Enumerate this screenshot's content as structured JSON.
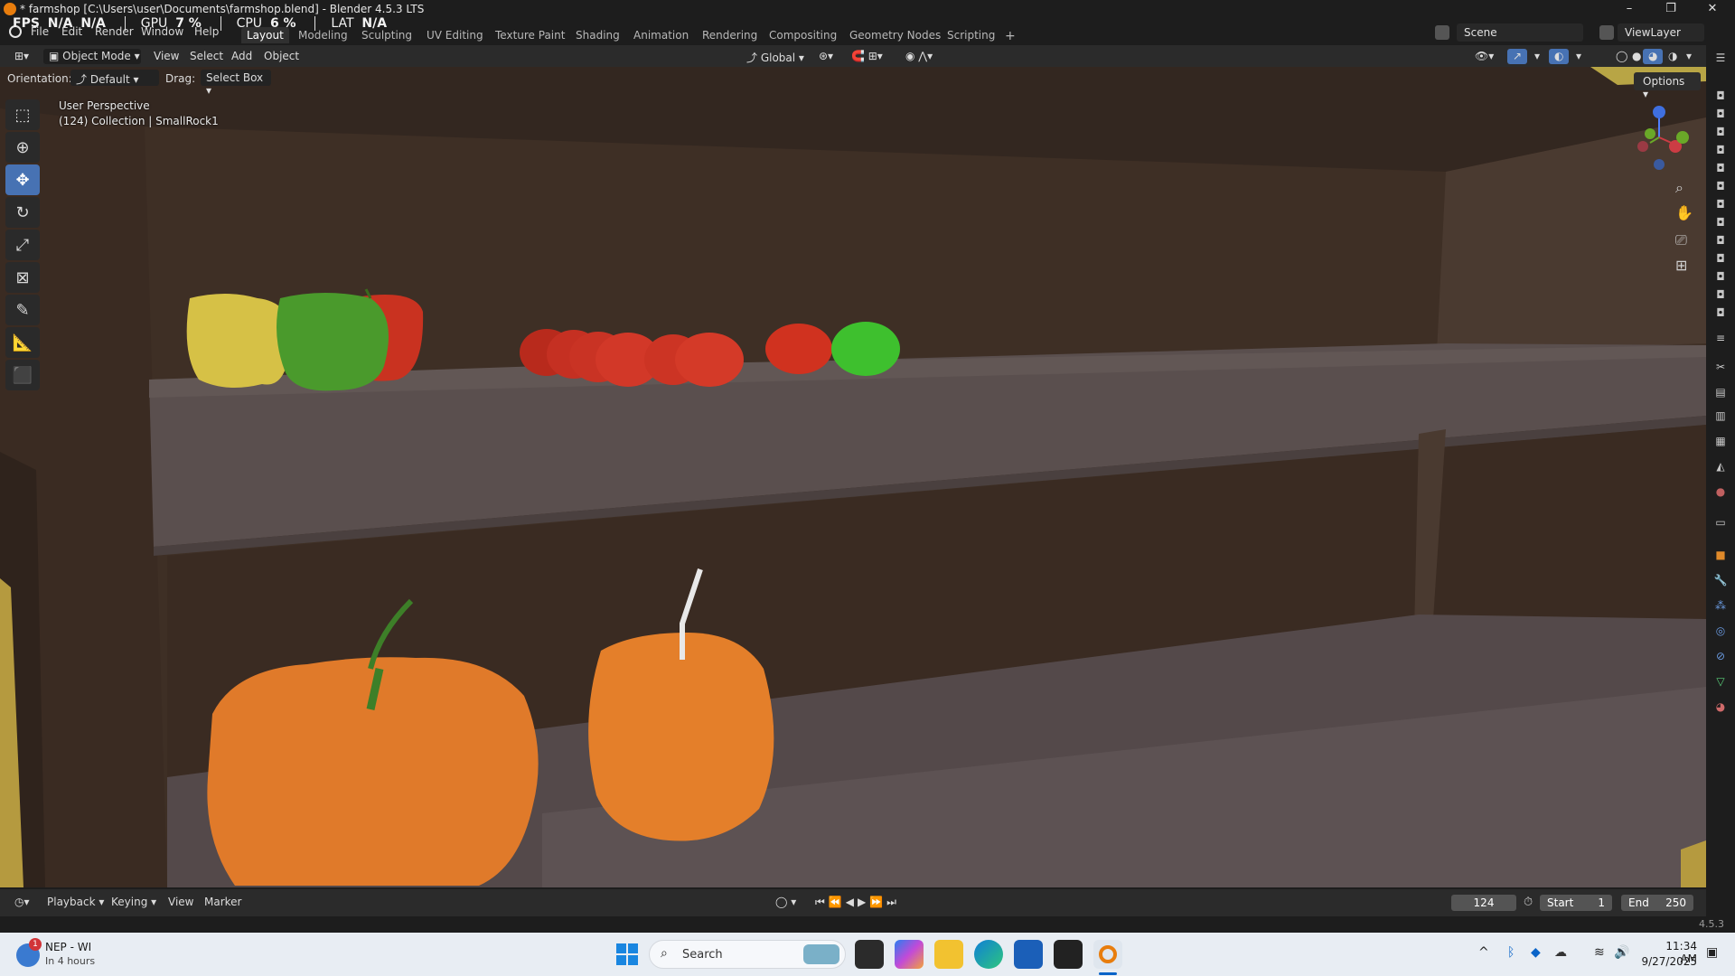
{
  "window": {
    "title": "* farmshop [C:\\Users\\user\\Documents\\farmshop.blend] - Blender 4.5.3 LTS",
    "controls": [
      "–",
      "❐",
      "✕"
    ]
  },
  "perf_overlay": {
    "fps_label": "FPS",
    "fps_value": "N/A",
    "fps_value2": "N/A",
    "gpu_label": "GPU",
    "gpu_value": "7 %",
    "cpu_label": "CPU",
    "cpu_value": "6 %",
    "lat_label": "LAT",
    "lat_value": "N/A"
  },
  "menu": {
    "items": [
      "File",
      "Edit",
      "Render",
      "Window",
      "Help"
    ]
  },
  "workspaces": {
    "tabs": [
      "Layout",
      "Modeling",
      "Sculpting",
      "UV Editing",
      "Texture Paint",
      "Shading",
      "Animation",
      "Rendering",
      "Compositing",
      "Geometry Nodes",
      "Scripting"
    ],
    "active": "Layout",
    "add": "+"
  },
  "scene": {
    "name": "Scene",
    "viewlayer": "ViewLayer"
  },
  "viewport_header": {
    "mode": "Object Mode",
    "menus": [
      "View",
      "Select",
      "Add",
      "Object"
    ],
    "transform_orientation": "Global",
    "orientation_label": "Orientation:",
    "orientation_value": "Default",
    "drag_label": "Drag:",
    "drag_value": "Select Box",
    "options": "Options"
  },
  "viewport_info": {
    "line1": "User Perspective",
    "line2": "(124) Collection | SmallRock1"
  },
  "gizmo": {
    "z": "Z",
    "y": "Y",
    "x": "X"
  },
  "timeline": {
    "menus": [
      "Playback",
      "Keying",
      "View",
      "Marker"
    ],
    "current_frame": "124",
    "start_label": "Start",
    "start_value": "1",
    "end_label": "End",
    "end_value": "250"
  },
  "statusbar": {
    "version": "4.5.3"
  },
  "taskbar": {
    "weather_title": "NEP - WI",
    "weather_sub": "In 4 hours",
    "weather_badge": "1",
    "search_placeholder": "Search",
    "time": "11:34 AM",
    "date": "9/27/2025"
  },
  "colors": {
    "accent": "#4772b3",
    "blender_orange": "#e87d0d",
    "wall": "#3e2f25",
    "shelf": "#5a4f4e"
  }
}
